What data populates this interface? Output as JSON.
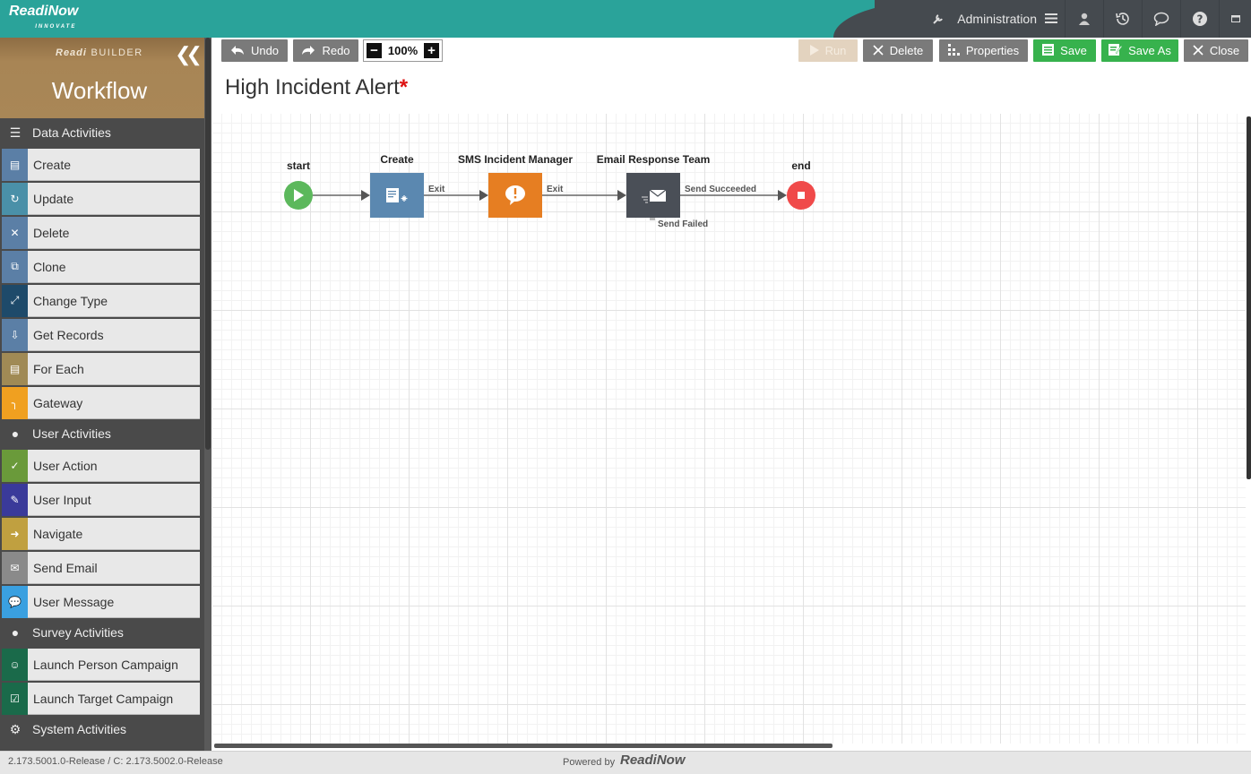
{
  "app": {
    "logo": "ReadiNow",
    "logo_sub": "INNOVATE"
  },
  "topnav": {
    "admin_label": "Administration",
    "icons": [
      "wrench-icon",
      "hamburger-icon",
      "user-icon",
      "history-icon",
      "chat-icon",
      "help-icon",
      "window-icon"
    ]
  },
  "sidebar": {
    "builder_brand": "Readi",
    "builder_suffix": "BUILDER",
    "title": "Workflow",
    "categories": [
      {
        "label": "Data Activities",
        "items": [
          {
            "label": "Create",
            "color": "#5b7fa6"
          },
          {
            "label": "Update",
            "color": "#4a90a8"
          },
          {
            "label": "Delete",
            "color": "#5b7fa6"
          },
          {
            "label": "Clone",
            "color": "#5b7fa6"
          },
          {
            "label": "Change Type",
            "color": "#1e4a6a"
          },
          {
            "label": "Get Records",
            "color": "#5b7fa6"
          },
          {
            "label": "For Each",
            "color": "#a08a55"
          },
          {
            "label": "Gateway",
            "color": "#f0a020"
          }
        ]
      },
      {
        "label": "User Activities",
        "items": [
          {
            "label": "User Action",
            "color": "#6a9a3a"
          },
          {
            "label": "User Input",
            "color": "#3a3a9a"
          },
          {
            "label": "Navigate",
            "color": "#c0a040"
          },
          {
            "label": "Send Email",
            "color": "#8a8a8a"
          },
          {
            "label": "User Message",
            "color": "#3aa0e0"
          }
        ]
      },
      {
        "label": "Survey Activities",
        "items": [
          {
            "label": "Launch Person Campaign",
            "color": "#1a6a4a"
          },
          {
            "label": "Launch Target Campaign",
            "color": "#1a6a4a"
          }
        ]
      },
      {
        "label": "System Activities",
        "items": []
      }
    ]
  },
  "toolbar": {
    "undo": "Undo",
    "redo": "Redo",
    "zoom": "100%",
    "run": "Run",
    "delete": "Delete",
    "properties": "Properties",
    "save": "Save",
    "save_as": "Save As",
    "close": "Close"
  },
  "document": {
    "title": "High Incident Alert",
    "dirty_marker": "*"
  },
  "workflow": {
    "nodes": {
      "start": "start",
      "create": "Create",
      "sms": "SMS Incident Manager",
      "email": "Email Response Team",
      "end": "end"
    },
    "edges": {
      "create_exit": "Exit",
      "sms_exit": "Exit",
      "email_success": "Send Succeeded",
      "email_failed": "Send Failed"
    },
    "colors": {
      "start": "#5cb85c",
      "create": "#5b88b0",
      "sms": "#e67e22",
      "email": "#4a4f57",
      "end": "#f04a4a"
    }
  },
  "footer": {
    "version": "2.173.5001.0-Release / C: 2.173.5002.0-Release",
    "powered_by": "Powered by",
    "logo": "ReadiNow"
  }
}
